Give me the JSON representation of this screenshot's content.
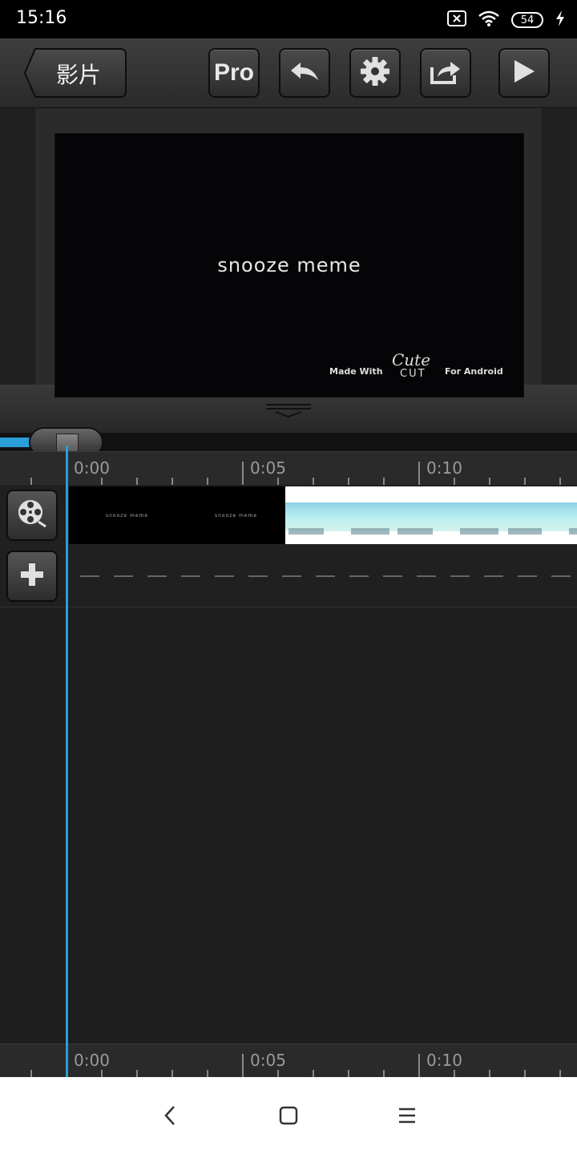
{
  "status_bar": {
    "time": "15:16",
    "battery": "54",
    "icons": [
      "sim-off-icon",
      "wifi-icon",
      "battery-icon",
      "charging-icon"
    ]
  },
  "toolbar": {
    "back_label": "影片",
    "pro_label": "Pro",
    "buttons": [
      "undo-icon",
      "gear-icon",
      "share-icon",
      "play-icon"
    ]
  },
  "preview": {
    "title": "snooze meme",
    "watermark_left": "Made With",
    "watermark_logo_top": "Cute",
    "watermark_logo_bottom": "CUT",
    "watermark_right": "For Android"
  },
  "timeline": {
    "ruler_labels": [
      "0:00",
      "0:05",
      "0:10"
    ],
    "progress": 0.08
  },
  "tracks": {
    "video_track_icon": "film-reel-icon",
    "add_track_icon": "plus-icon",
    "clip1_texts": [
      "snooze meme",
      "snooze meme"
    ]
  },
  "colors": {
    "accent": "#2a9ed8",
    "background": "#1c1c1c",
    "toolbar": "#353535"
  },
  "nav_bar": {
    "icons": [
      "back-icon",
      "home-icon",
      "menu-icon"
    ]
  }
}
